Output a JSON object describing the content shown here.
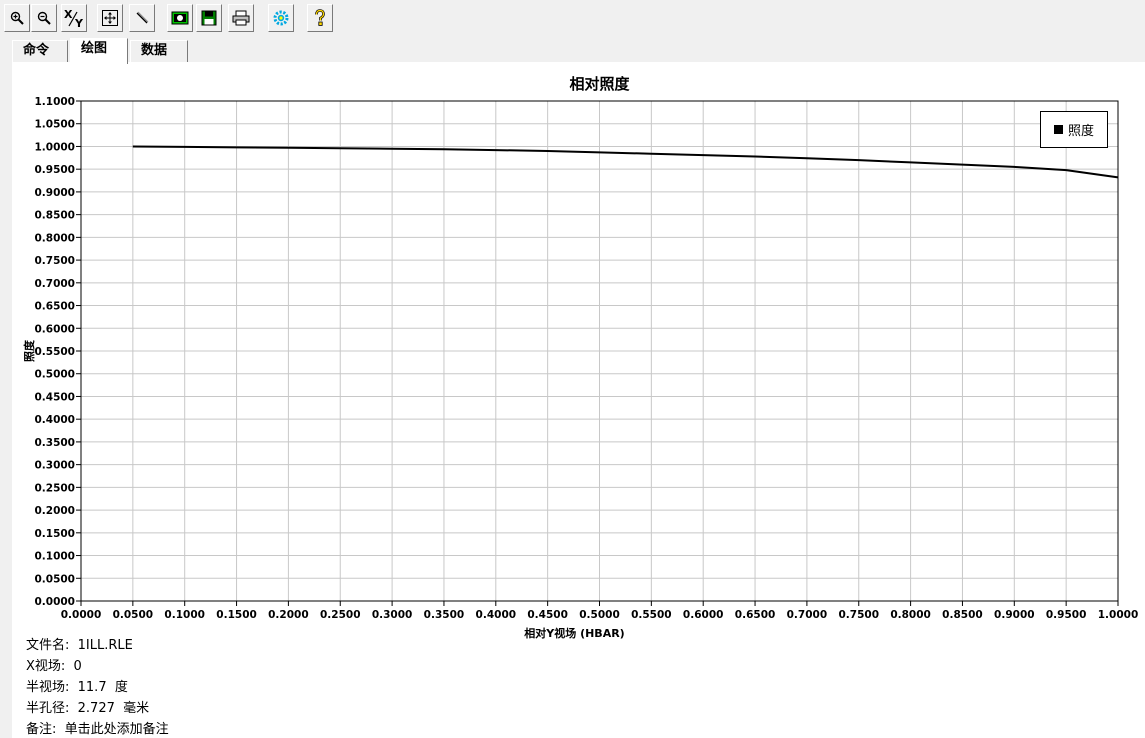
{
  "toolbar": {
    "buttons": [
      {
        "name": "zoom-in-button",
        "icon": "zoom-in-icon"
      },
      {
        "name": "zoom-out-button",
        "icon": "zoom-out-icon"
      },
      {
        "name": "xy-button",
        "icon": "xy-icon",
        "label_x": "X",
        "label_y": "Y"
      },
      {
        "name": "fit-button",
        "icon": "fit-icon"
      },
      {
        "name": "pencil-button",
        "icon": "pencil-icon"
      },
      {
        "name": "camera-button",
        "icon": "camera-icon"
      },
      {
        "name": "save-button",
        "icon": "floppy-icon"
      },
      {
        "name": "print-button",
        "icon": "printer-icon"
      },
      {
        "name": "settings-button",
        "icon": "gear-icon"
      },
      {
        "name": "help-button",
        "icon": "help-icon"
      }
    ]
  },
  "tabs": [
    {
      "label": "命令",
      "active": false
    },
    {
      "label": "绘图",
      "active": true
    },
    {
      "label": "数据",
      "active": false
    }
  ],
  "info": {
    "filename": "文件名:  1ILL.RLE",
    "xfield": "X视场:  0",
    "halffield": "半视场:  11.7  度",
    "halfaperture": "半孔径:  2.727  毫米",
    "note": "备注:  单击此处添加备注"
  },
  "chart_data": {
    "type": "line",
    "title": "相对照度",
    "xlabel": "相对Y视场 (HBAR)",
    "ylabel": "照度",
    "xlim": [
      0.0,
      1.0
    ],
    "ylim": [
      0.0,
      1.1
    ],
    "xticks": [
      "0.0000",
      "0.0500",
      "0.1000",
      "0.1500",
      "0.2000",
      "0.2500",
      "0.3000",
      "0.3500",
      "0.4000",
      "0.4500",
      "0.5000",
      "0.5500",
      "0.6000",
      "0.6500",
      "0.7000",
      "0.7500",
      "0.8000",
      "0.8500",
      "0.9000",
      "0.9500",
      "1.0000"
    ],
    "yticks": [
      "0.0000",
      "0.0500",
      "0.1000",
      "0.1500",
      "0.2000",
      "0.2500",
      "0.3000",
      "0.3500",
      "0.4000",
      "0.4500",
      "0.5000",
      "0.5500",
      "0.6000",
      "0.6500",
      "0.7000",
      "0.7500",
      "0.8000",
      "0.8500",
      "0.9000",
      "0.9500",
      "1.0000",
      "1.0500",
      "1.1000"
    ],
    "grid": true,
    "legend_position": "top-right",
    "series": [
      {
        "name": "照度",
        "color": "#000000",
        "x": [
          0.05,
          0.1,
          0.15,
          0.2,
          0.25,
          0.3,
          0.35,
          0.4,
          0.45,
          0.5,
          0.55,
          0.6,
          0.65,
          0.7,
          0.75,
          0.8,
          0.85,
          0.9,
          0.95,
          1.0
        ],
        "y": [
          1.0,
          0.999,
          0.998,
          0.997,
          0.996,
          0.995,
          0.994,
          0.992,
          0.99,
          0.987,
          0.984,
          0.981,
          0.978,
          0.974,
          0.97,
          0.965,
          0.96,
          0.955,
          0.948,
          0.932
        ]
      }
    ]
  }
}
